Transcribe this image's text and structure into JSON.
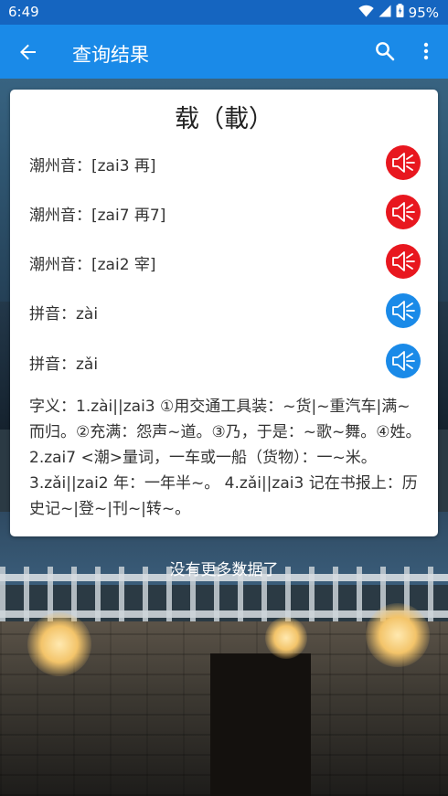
{
  "status_bar": {
    "time": "6:49",
    "battery": "95%"
  },
  "app_bar": {
    "title": "查询结果"
  },
  "card": {
    "heading": "载（載）",
    "pronunciations": [
      {
        "label": "潮州音：[zai3 再]",
        "button_color": "#e8171f"
      },
      {
        "label": "潮州音：[zai7 再7]",
        "button_color": "#e8171f"
      },
      {
        "label": "潮州音：[zai2 宰]",
        "button_color": "#e8171f"
      },
      {
        "label": "拼音：zài",
        "button_color": "#1a8ae8"
      },
      {
        "label": "拼音：zǎi",
        "button_color": "#1a8ae8"
      }
    ],
    "meaning": "字义：1.zài||zai3 ①用交通工具装：~货|~重汽车|满~而归。②充满：怨声~道。③乃，于是：~歌~舞。④姓。 2.zai7 <潮>量词，一车或一船（货物）：一~米。 3.zǎi||zai2 年：一年半~。 4.zǎi||zai3 记在书报上：历史记~|登~|刊~|转~。"
  },
  "footer": {
    "no_more": "没有更多数据了"
  },
  "colors": {
    "status_bar": "#1565c0",
    "app_bar": "#1a8ae8",
    "speaker_red": "#e8171f",
    "speaker_blue": "#1a8ae8"
  }
}
